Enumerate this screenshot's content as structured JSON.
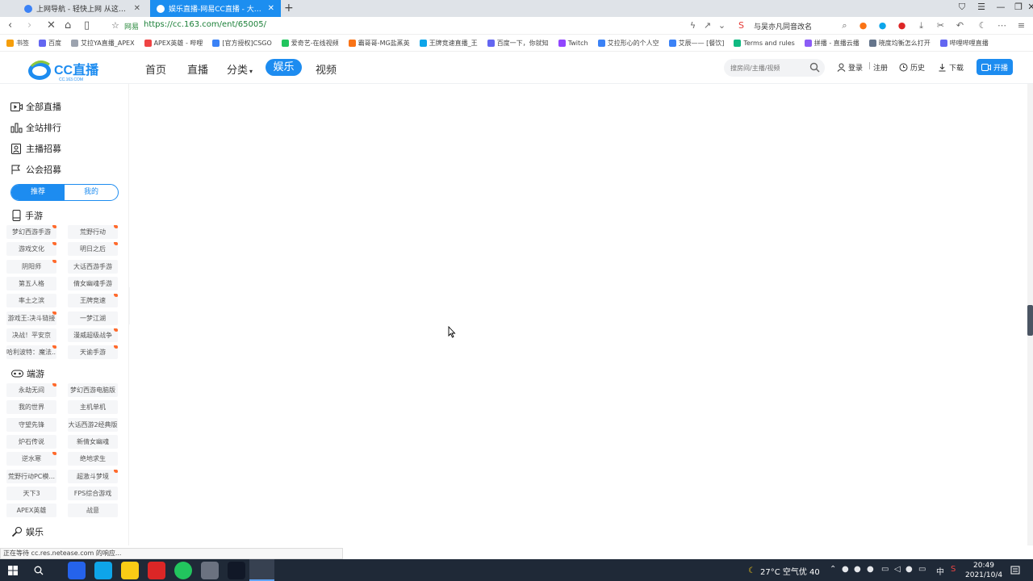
{
  "browser": {
    "tabs": [
      {
        "title": "上网导航 - 轻快上网 从这里开始",
        "active": false
      },
      {
        "title": "娱乐直播-网易CC直播 - 大型游戏影",
        "active": true
      }
    ],
    "address": {
      "site_label": "网易",
      "url": "https://cc.163.com/ent/65005/"
    },
    "search_suggest": "与吴亦凡同音改名",
    "bookmarks": [
      "书签",
      "百度",
      "艾拉YA直播_APEX",
      "APEX英雄 - 哔哩",
      "[官方授权]CSGO",
      "爱奇艺-在线视频",
      "霸哥哥-MG盐蒸英",
      "王牌竞速直播_王",
      "百度一下，你就知",
      "Twitch",
      "艾拉形心的个人空",
      "艾辰—— [餐饮]",
      "Terms and rules",
      "拼播 - 直播云播",
      "晓度均衡怎么打开",
      "哔哩哔哩直播"
    ]
  },
  "header": {
    "nav": [
      "首页",
      "直播",
      "分类",
      "娱乐",
      "视频"
    ],
    "active_nav": "娱乐",
    "search_placeholder": "搜房间/主播/视频",
    "login": "登录",
    "register": "注册",
    "history": "历史",
    "download": "下载",
    "start_live": "开播"
  },
  "sidebar": {
    "links": [
      "全部直播",
      "全站排行",
      "主播招募",
      "公会招募"
    ],
    "toggle": {
      "recommend": "推荐",
      "mine": "我的"
    },
    "sections": [
      {
        "title": "手游",
        "items": [
          {
            "label": "梦幻西游手游",
            "hot": true
          },
          {
            "label": "荒野行动",
            "hot": true
          },
          {
            "label": "游戏文化",
            "hot": true
          },
          {
            "label": "明日之后",
            "hot": true
          },
          {
            "label": "阴阳师",
            "hot": true
          },
          {
            "label": "大话西游手游",
            "hot": false
          },
          {
            "label": "第五人格",
            "hot": false
          },
          {
            "label": "倩女幽魂手游",
            "hot": false
          },
          {
            "label": "率土之滨",
            "hot": false
          },
          {
            "label": "王牌竞速",
            "hot": true
          },
          {
            "label": "游戏王:决斗链接",
            "hot": true
          },
          {
            "label": "一梦江湖",
            "hot": false
          },
          {
            "label": "决战！平安京",
            "hot": false
          },
          {
            "label": "漫威超级战争",
            "hot": true
          },
          {
            "label": "哈利波特：魔法...",
            "hot": true
          },
          {
            "label": "天谕手游",
            "hot": true
          }
        ]
      },
      {
        "title": "端游",
        "items": [
          {
            "label": "永劫无间",
            "hot": true
          },
          {
            "label": "梦幻西游电脑版",
            "hot": false
          },
          {
            "label": "我的世界",
            "hot": false
          },
          {
            "label": "主机单机",
            "hot": false
          },
          {
            "label": "守望先锋",
            "hot": false
          },
          {
            "label": "大话西游2经典版",
            "hot": false
          },
          {
            "label": "炉石传说",
            "hot": false
          },
          {
            "label": "新倩女幽魂",
            "hot": false
          },
          {
            "label": "逆水寒",
            "hot": true
          },
          {
            "label": "绝地求生",
            "hot": false
          },
          {
            "label": "荒野行动PC模...",
            "hot": false
          },
          {
            "label": "超激斗梦境",
            "hot": true
          },
          {
            "label": "天下3",
            "hot": false
          },
          {
            "label": "FPS综合游戏",
            "hot": false
          },
          {
            "label": "APEX英雄",
            "hot": false
          },
          {
            "label": "战意",
            "hot": false
          }
        ]
      },
      {
        "title": "娱乐",
        "items": []
      }
    ]
  },
  "status_text": "正在等待 cc.res.netease.com 的响应...",
  "taskbar": {
    "weather": "27°C 空气优 40",
    "ime": "中",
    "time": "20:49",
    "date": "2021/10/4"
  }
}
